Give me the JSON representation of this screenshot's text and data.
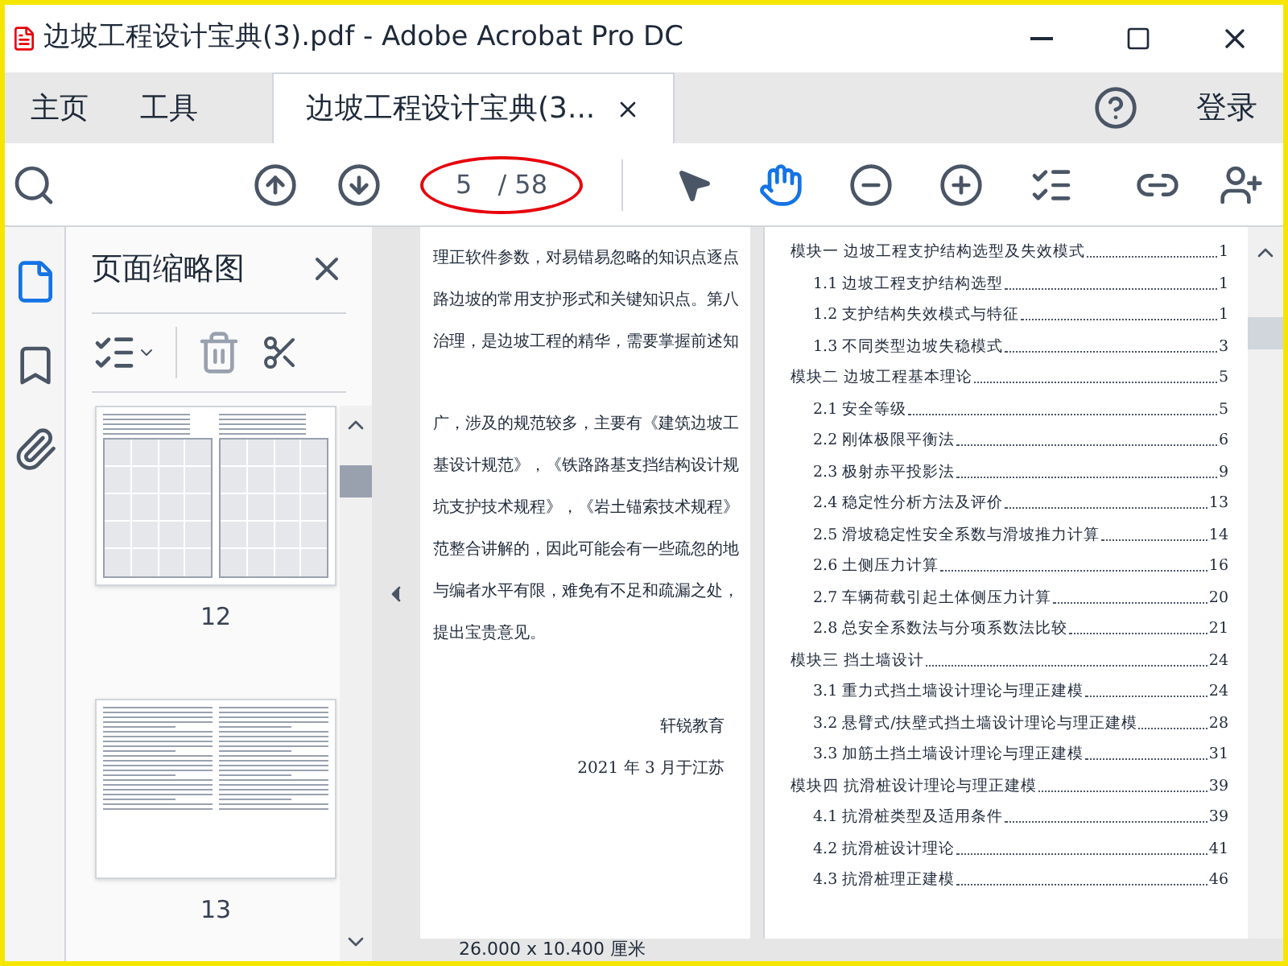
{
  "window": {
    "title": "边坡工程设计宝典(3).pdf - Adobe Acrobat Pro DC"
  },
  "tabs": [
    {
      "label": "主页",
      "selected": false
    },
    {
      "label": "工具",
      "selected": false
    },
    {
      "label": "边坡工程设计宝典(3...",
      "selected": true,
      "closable": true
    }
  ],
  "sign_in": "登录",
  "toolbar": {
    "page_current": "5",
    "page_total": "/ 58",
    "hand_tool_active": true
  },
  "thumbnails_panel": {
    "title": "页面缩略图",
    "pages": [
      {
        "label": "12",
        "kind": "figure"
      },
      {
        "label": "13",
        "kind": "text"
      }
    ]
  },
  "document": {
    "left_page": {
      "paragraphs": [
        [
          "理正软件参数，对易错易忽略的知识点逐点",
          "路边坡的常用支护形式和关键知识点。第八",
          "治理，是边坡工程的精华，需要掌握前述知"
        ],
        [
          "广，涉及的规范较多，主要有《建筑边坡工",
          "基设计规范》，《铁路路基支挡结构设计规",
          "坑支护技术规程》，《岩土锚索技术规程》",
          "范整合讲解的，因此可能会有一些疏忽的地",
          "与编者水平有限，难免有不足和疏漏之处，",
          "提出宝贵意见。"
        ]
      ],
      "signature": "轩锐教育",
      "date": "2021 年 3 月于江苏"
    },
    "toc": [
      {
        "title": "模块一  边坡工程支护结构选型及失效模式",
        "page": "1",
        "children": [
          {
            "title": "1.1 边坡工程支护结构选型",
            "page": "1"
          },
          {
            "title": "1.2 支护结构失效模式与特征",
            "page": "1"
          },
          {
            "title": "1.3 不同类型边坡失稳模式",
            "page": "3"
          }
        ]
      },
      {
        "title": "模块二   边坡工程基本理论",
        "page": "5",
        "children": [
          {
            "title": "2.1 安全等级",
            "page": "5"
          },
          {
            "title": "2.2 刚体极限平衡法",
            "page": "6"
          },
          {
            "title": "2.3 极射赤平投影法",
            "page": "9"
          },
          {
            "title": "2.4 稳定性分析方法及评价",
            "page": "13"
          },
          {
            "title": "2.5 滑坡稳定性安全系数与滑坡推力计算",
            "page": "14"
          },
          {
            "title": "2.6 土侧压力计算",
            "page": "16"
          },
          {
            "title": "2.7 车辆荷载引起土体侧压力计算",
            "page": "20"
          },
          {
            "title": "2.8 总安全系数法与分项系数法比较",
            "page": "21"
          }
        ]
      },
      {
        "title": "模块三   挡土墙设计",
        "page": "24",
        "children": [
          {
            "title": "3.1 重力式挡土墙设计理论与理正建模",
            "page": "24"
          },
          {
            "title": "3.2 悬臂式/扶壁式挡土墙设计理论与理正建模",
            "page": "28"
          },
          {
            "title": "3.3 加筋土挡土墙设计理论与理正建模",
            "page": "31"
          }
        ]
      },
      {
        "title": "模块四   抗滑桩设计理论与理正建模",
        "page": "39",
        "children": [
          {
            "title": "4.1 抗滑桩类型及适用条件",
            "page": "39"
          },
          {
            "title": "4.2 抗滑桩设计理论",
            "page": "41"
          },
          {
            "title": "4.3 抗滑桩理正建模",
            "page": "46"
          }
        ]
      }
    ]
  },
  "status_bar": {
    "page_size": "26.000 x 10.400 厘米"
  }
}
